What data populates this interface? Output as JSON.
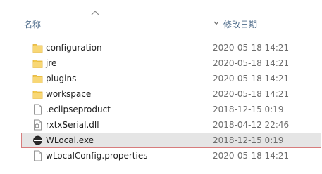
{
  "header": {
    "name_label": "名称",
    "date_label": "修改日期"
  },
  "files": [
    {
      "name": "configuration",
      "date": "2020-05-18 14:21",
      "icon": "folder-icon",
      "selected": false
    },
    {
      "name": "jre",
      "date": "2020-05-18 14:21",
      "icon": "folder-icon",
      "selected": false
    },
    {
      "name": "plugins",
      "date": "2020-05-18 14:21",
      "icon": "folder-icon",
      "selected": false
    },
    {
      "name": "workspace",
      "date": "2020-05-18 14:21",
      "icon": "folder-icon",
      "selected": false
    },
    {
      "name": ".eclipseproduct",
      "date": "2018-12-15 0:19",
      "icon": "file-icon",
      "selected": false
    },
    {
      "name": "rxtxSerial.dll",
      "date": "2018-04-12 22:46",
      "icon": "dll-icon",
      "selected": false
    },
    {
      "name": "WLocal.exe",
      "date": "2018-12-15 0:19",
      "icon": "exe-icon",
      "selected": true
    },
    {
      "name": "wLocalConfig.properties",
      "date": "2020-05-18 14:21",
      "icon": "file-icon",
      "selected": false
    }
  ],
  "colors": {
    "folder": "#f2c94c",
    "selection_bg": "#e5e5e5",
    "selection_border": "#d77d7d",
    "header_text": "#4d6b8a"
  }
}
